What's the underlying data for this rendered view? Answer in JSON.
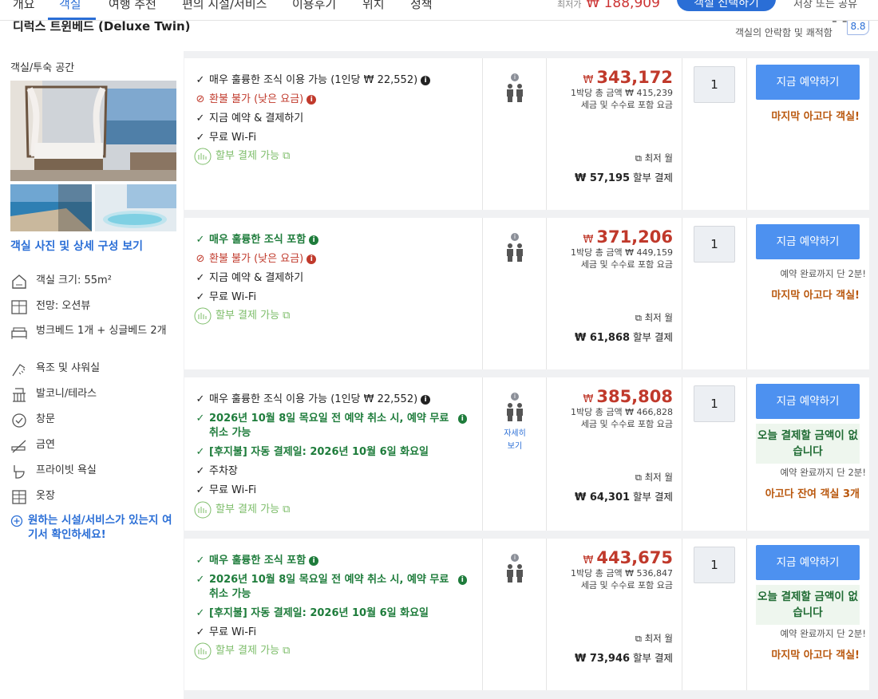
{
  "nav": {
    "tabs": [
      "개요",
      "객실",
      "여행 추천",
      "편의 시설/서비스",
      "이용후기",
      "위치",
      "정책"
    ],
    "active_tab": "객실",
    "price_label": "최저가",
    "price": "₩ 188,909",
    "cta": "객실 선택하기",
    "right_text": "저장 또는 공유"
  },
  "room": {
    "title": "디럭스 트윈베드 (Deluxe Twin)",
    "rating_label": "객실의 안락함 및 쾌적함",
    "rating": "8.8"
  },
  "left": {
    "section_title": "객실/투숙 공간",
    "photo_link": "객실 사진 및 상세 구성 보기",
    "features": [
      {
        "icon": "room-size-icon",
        "label": "객실 크기: 55m²"
      },
      {
        "icon": "window-view-icon",
        "label": "전망: 오션뷰"
      },
      {
        "icon": "bed-icon",
        "label": "벙크베드 1개 + 싱글베드 2개"
      },
      {
        "icon": "shower-icon",
        "label": "욕조 및 샤워실"
      },
      {
        "icon": "balcony-icon",
        "label": "발코니/테라스"
      },
      {
        "icon": "window-icon",
        "label": "창문"
      },
      {
        "icon": "no-smoking-icon",
        "label": "금연"
      },
      {
        "icon": "private-bathroom-icon",
        "label": "프라이빗 욕실"
      },
      {
        "icon": "wardrobe-icon",
        "label": "옷장"
      }
    ],
    "more_link": "원하는 시설/서비스가 있는지 여기서 확인하세요!"
  },
  "offers": [
    {
      "benefits": [
        {
          "type": "plain",
          "mark": "✓",
          "text": "매우 훌륭한 조식 이용 가능 (1인당 ₩ 22,552)",
          "info": "k"
        },
        {
          "type": "red",
          "mark": "⊘",
          "text": "환불 불가 (낮은 요금)",
          "info": "r"
        },
        {
          "type": "plain",
          "mark": "✓",
          "text": "지금 예약 & 결제하기"
        },
        {
          "type": "plain",
          "mark": "✓",
          "text": "무료 Wi-Fi"
        },
        {
          "type": "inst",
          "mark": "",
          "text": "할부 결제 가능 ⧉"
        }
      ],
      "occupancy_more": "",
      "currency": "₩",
      "price": "343,172",
      "total_label": "1박당 총 금액 ₩ 415,239",
      "tax_label": "세금 및 수수료 포함 요금",
      "monthly_label": "⧉ 최저 월",
      "installment": "₩ 57,195",
      "installment_suffix": "할부 결제",
      "qty": "1",
      "book": "지금 예약하기",
      "free_now": "",
      "note": "",
      "urgency": "마지막 아고다 객실!"
    },
    {
      "benefits": [
        {
          "type": "green",
          "mark": "✓",
          "text": "매우 훌륭한 조식 포함",
          "info": "g"
        },
        {
          "type": "red",
          "mark": "⊘",
          "text": "환불 불가 (낮은 요금)",
          "info": "r"
        },
        {
          "type": "plain",
          "mark": "✓",
          "text": "지금 예약 & 결제하기"
        },
        {
          "type": "plain",
          "mark": "✓",
          "text": "무료 Wi-Fi"
        },
        {
          "type": "inst",
          "mark": "",
          "text": "할부 결제 가능 ⧉"
        }
      ],
      "occupancy_more": "",
      "currency": "₩",
      "price": "371,206",
      "total_label": "1박당 총 금액 ₩ 449,159",
      "tax_label": "세금 및 수수료 포함 요금",
      "monthly_label": "⧉ 최저 월",
      "installment": "₩ 61,868",
      "installment_suffix": "할부 결제",
      "qty": "1",
      "book": "지금 예약하기",
      "free_now": "",
      "note": "예약 완료까지 단 2분!",
      "urgency": "마지막 아고다 객실!"
    },
    {
      "benefits": [
        {
          "type": "plain",
          "mark": "✓",
          "text": "매우 훌륭한 조식 이용 가능 (1인당 ₩ 22,552)",
          "info": "k"
        },
        {
          "type": "green",
          "mark": "✓",
          "text": "2026년 10월 8일 목요일 전 예약 취소 시, 예약 무료 취소 가능",
          "info": "g"
        },
        {
          "type": "green",
          "mark": "✓",
          "text": "[후지불] 자동 결제일: 2026년 10월 6일 화요일"
        },
        {
          "type": "plain",
          "mark": "✓",
          "text": "주차장"
        },
        {
          "type": "plain",
          "mark": "✓",
          "text": "무료 Wi-Fi"
        },
        {
          "type": "inst",
          "mark": "",
          "text": "할부 결제 가능 ⧉"
        }
      ],
      "occupancy_more": "자세히 보기",
      "currency": "₩",
      "price": "385,808",
      "total_label": "1박당 총 금액 ₩ 466,828",
      "tax_label": "세금 및 수수료 포함 요금",
      "monthly_label": "⧉ 최저 월",
      "installment": "₩ 64,301",
      "installment_suffix": "할부 결제",
      "qty": "1",
      "book": "지금 예약하기",
      "free_now": "오늘 결제할 금액이 없습니다",
      "note": "예약 완료까지 단 2분!",
      "urgency": "아고다 잔여 객실 3개"
    },
    {
      "benefits": [
        {
          "type": "green",
          "mark": "✓",
          "text": "매우 훌륭한 조식 포함",
          "info": "g"
        },
        {
          "type": "green",
          "mark": "✓",
          "text": "2026년 10월 8일 목요일 전 예약 취소 시, 예약 무료 취소 가능",
          "info": "g"
        },
        {
          "type": "green",
          "mark": "✓",
          "text": "[후지불] 자동 결제일: 2026년 10월 6일 화요일"
        },
        {
          "type": "plain",
          "mark": "✓",
          "text": "무료 Wi-Fi"
        },
        {
          "type": "inst",
          "mark": "",
          "text": "할부 결제 가능 ⧉"
        }
      ],
      "occupancy_more": "",
      "currency": "₩",
      "price": "443,675",
      "total_label": "1박당 총 금액 ₩ 536,847",
      "tax_label": "세금 및 수수료 포함 요금",
      "monthly_label": "⧉ 최저 월",
      "installment": "₩ 73,946",
      "installment_suffix": "할부 결제",
      "qty": "1",
      "book": "지금 예약하기",
      "free_now": "오늘 결제할 금액이 없습니다",
      "note": "예약 완료까지 단 2분!",
      "urgency": "마지막 아고다 객실!"
    }
  ]
}
